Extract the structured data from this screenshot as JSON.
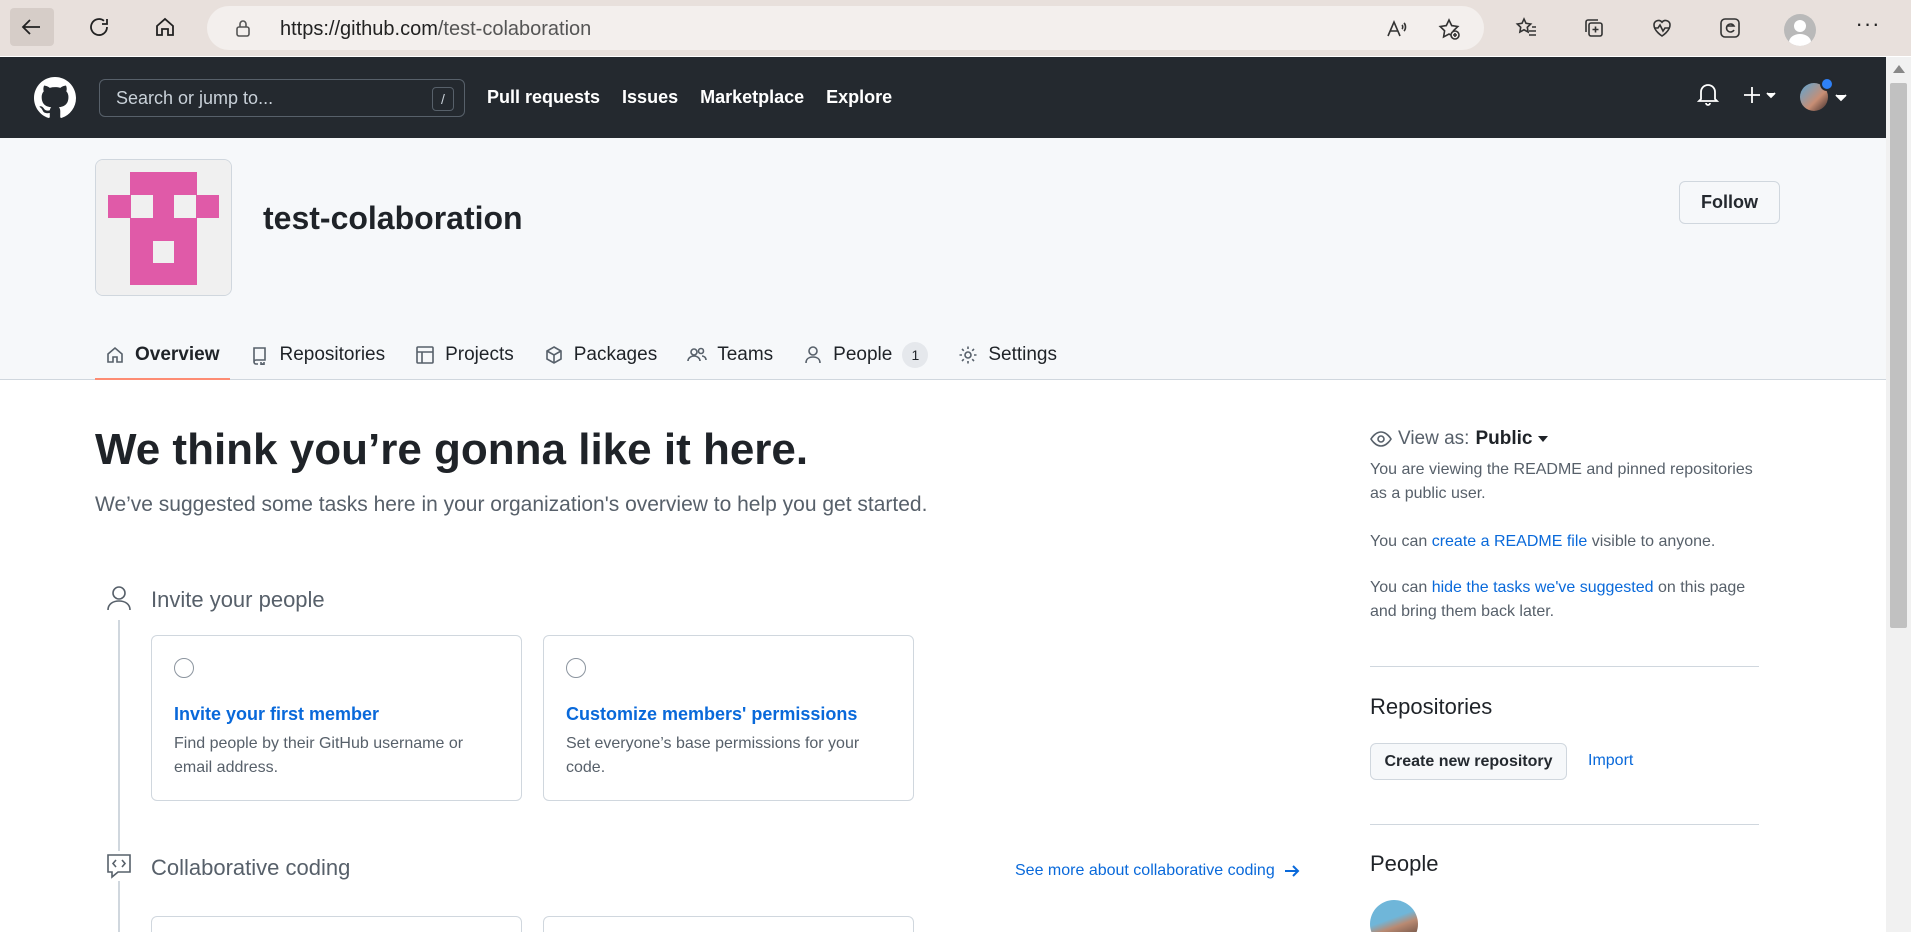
{
  "browser": {
    "url_host": "https://github.com",
    "url_path": "/test-colaboration",
    "icons": [
      "back-icon",
      "refresh-icon",
      "home-icon",
      "lock-icon",
      "read-aloud-icon",
      "add-favorite-icon",
      "favorites-icon",
      "collections-icon",
      "health-icon",
      "edge-icon",
      "profile-icon",
      "more-icon"
    ]
  },
  "github_header": {
    "search_placeholder": "Search or jump to...",
    "search_key": "/",
    "nav": [
      "Pull requests",
      "Issues",
      "Marketplace",
      "Explore"
    ]
  },
  "org": {
    "name": "test-colaboration",
    "follow_label": "Follow",
    "avatar_color": "#e05aa8"
  },
  "tabs": [
    {
      "label": "Overview",
      "icon": "home-icon",
      "active": true
    },
    {
      "label": "Repositories",
      "icon": "repo-icon"
    },
    {
      "label": "Projects",
      "icon": "table-icon"
    },
    {
      "label": "Packages",
      "icon": "package-icon"
    },
    {
      "label": "Teams",
      "icon": "people-icon"
    },
    {
      "label": "People",
      "icon": "person-icon",
      "count": "1"
    },
    {
      "label": "Settings",
      "icon": "gear-icon"
    }
  ],
  "main": {
    "title": "We think you’re gonna like it here.",
    "subtitle": "We’ve suggested some tasks here in your organization's overview to help you get started.",
    "sections": [
      {
        "title": "Invite your people",
        "cards": [
          {
            "title": "Invite your first member",
            "desc": "Find people by their GitHub username or email address."
          },
          {
            "title": "Customize members' permissions",
            "desc": "Set everyone’s base permissions for your code."
          }
        ]
      },
      {
        "title": "Collaborative coding",
        "link": "See more about collaborative coding"
      }
    ]
  },
  "sidebar": {
    "view_as_label": "View as:",
    "view_as_value": "Public",
    "viewing_text": "You are viewing the README and pinned repositories as a public user.",
    "readme_pre": "You can ",
    "readme_link": "create a README file",
    "readme_post": " visible to anyone.",
    "hide_pre": "You can ",
    "hide_link": "hide the tasks we've suggested",
    "hide_post": " on this page and bring them back later.",
    "repositories_title": "Repositories",
    "create_repo_label": "Create new repository",
    "import_label": "Import",
    "people_title": "People"
  }
}
